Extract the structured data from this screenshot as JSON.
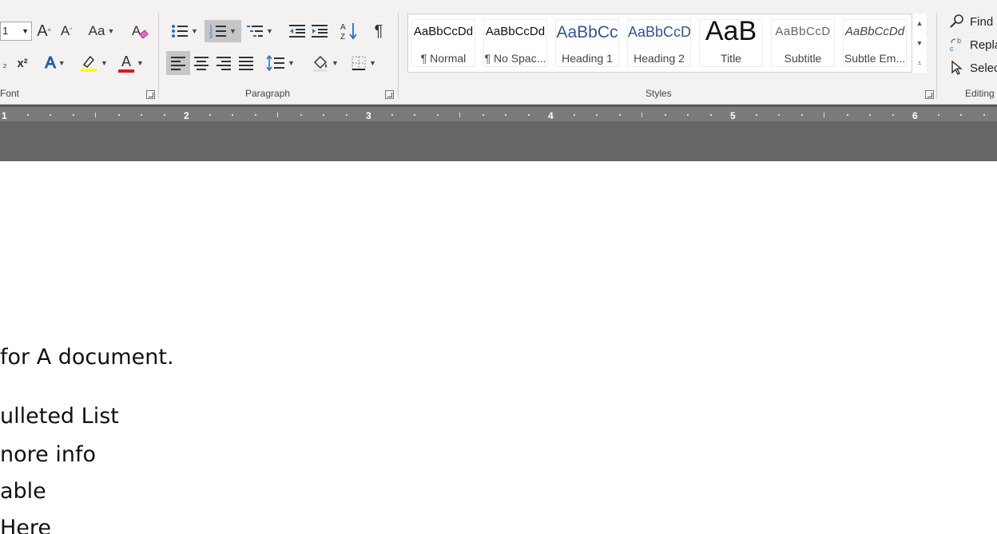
{
  "ribbon": {
    "font": {
      "label": "Font",
      "size_value": "1",
      "grow_glyph": "A",
      "shrink_glyph": "A",
      "change_case_glyph": "Aa",
      "subscript_glyph": "₂",
      "superscript_glyph": "x²",
      "text_effects_glyph": "A",
      "font_color_glyph": "A",
      "highlight_color": "#ffff00",
      "font_color": "#e81123"
    },
    "paragraph": {
      "label": "Paragraph",
      "sort_glyph": "A↓Z",
      "show_marks_glyph": "¶"
    },
    "styles": {
      "label": "Styles",
      "items": [
        {
          "preview": "AaBbCcDd",
          "name": "¶ Normal"
        },
        {
          "preview": "AaBbCcDd",
          "name": "¶ No Spac..."
        },
        {
          "preview": "AaBbCc",
          "name": "Heading 1"
        },
        {
          "preview": "AaBbCcD",
          "name": "Heading 2"
        },
        {
          "preview": "AaB",
          "name": "Title"
        },
        {
          "preview": "AaBbCcD",
          "name": "Subtitle"
        },
        {
          "preview": "AaBbCcDd",
          "name": "Subtle Em..."
        }
      ]
    },
    "editing": {
      "label": "Editing",
      "find": "Find",
      "replace": "Repla",
      "select": "Selec"
    }
  },
  "ruler": {
    "numbers": [
      "1",
      "2",
      "3",
      "4",
      "5",
      "6"
    ]
  },
  "document": {
    "lines": [
      "for A document.",
      "ulleted List",
      "nore info",
      "able",
      " Here"
    ]
  }
}
